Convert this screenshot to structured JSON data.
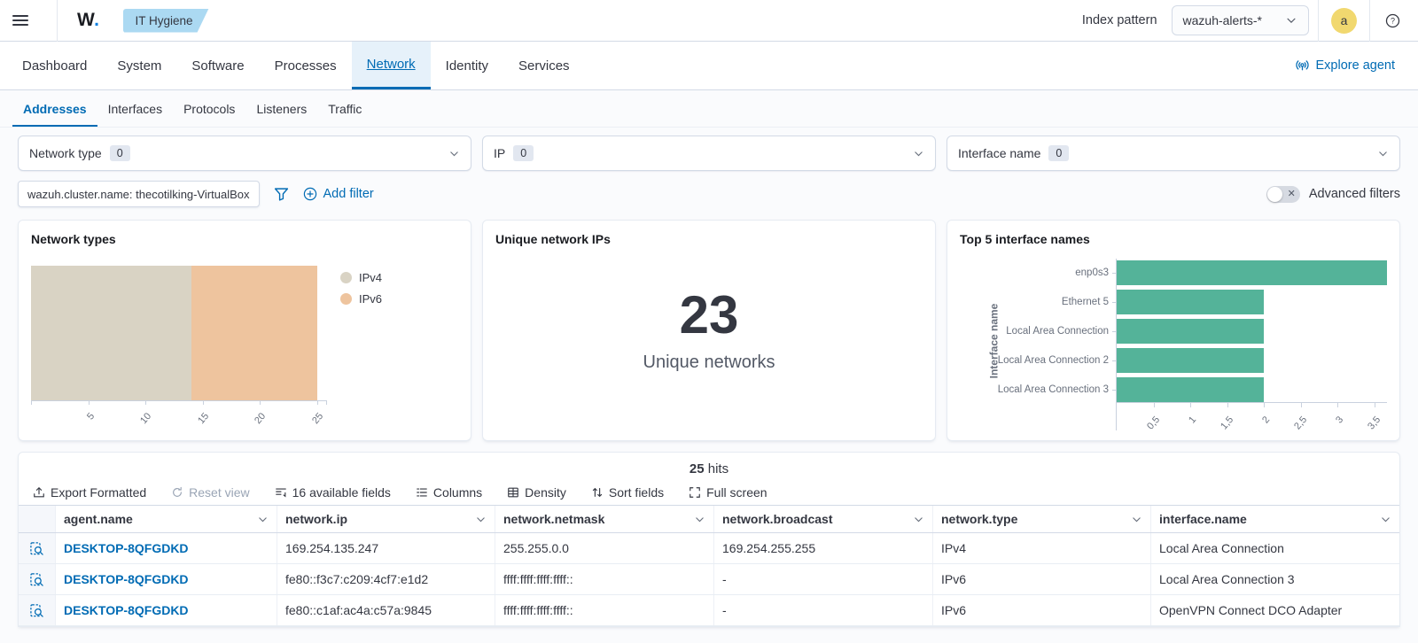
{
  "colors": {
    "accent_blue": "#006BB4",
    "badge_blue": "#abd9f2",
    "avatar_yellow": "#f1d86f",
    "bar_green": "#54b399",
    "ipv4_beige": "#d9d3c4",
    "ipv6_peach": "#eec49e"
  },
  "icons": {
    "menu-icon": "hamburger bars",
    "chevron-down-icon": "v chevron",
    "help-icon": "? in circle",
    "filter-funnel-icon": "funnel outline",
    "add-circle-icon": "plus in circle",
    "broadcast-icon": "((o)) signal",
    "export-icon": "arrow up from tray",
    "refresh-icon": "circular arrow",
    "fields-icon": "list with arrow",
    "columns-icon": "list lines",
    "density-icon": "table grid",
    "sort-icon": "up down arrows",
    "fullscreen-icon": "expand corners",
    "inspect-icon": "document with magnifier",
    "close-icon": "x mark"
  },
  "header": {
    "logo_text": "W",
    "logo_dot": ".",
    "module_badge": "IT Hygiene",
    "index_pattern_label": "Index pattern",
    "index_pattern_value": "wazuh-alerts-*",
    "avatar_initial": "a"
  },
  "nav": {
    "tabs": [
      "Dashboard",
      "System",
      "Software",
      "Processes",
      "Network",
      "Identity",
      "Services"
    ],
    "active": "Network",
    "explore_agent": "Explore agent"
  },
  "subnav": {
    "tabs": [
      "Addresses",
      "Interfaces",
      "Protocols",
      "Listeners",
      "Traffic"
    ],
    "active": "Addresses"
  },
  "filters": {
    "combos": [
      {
        "label": "Network type",
        "count": "0"
      },
      {
        "label": "IP",
        "count": "0"
      },
      {
        "label": "Interface name",
        "count": "0"
      }
    ],
    "pill": "wazuh.cluster.name: thecotilking-VirtualBox",
    "add_filter": "Add filter",
    "advanced_filters": "Advanced filters"
  },
  "chart_data": [
    {
      "type": "bar",
      "variant": "horizontal-stacked",
      "title": "Network types",
      "series": [
        {
          "name": "IPv4",
          "value": 14,
          "color": "#d9d3c4"
        },
        {
          "name": "IPv6",
          "value": 11,
          "color": "#eec49e"
        }
      ],
      "xlim": [
        0,
        25
      ],
      "x_ticks": [
        5,
        10,
        15,
        20,
        25
      ],
      "legend_position": "right",
      "grid": false
    },
    {
      "type": "metric",
      "title": "Unique network IPs",
      "value": "23",
      "label": "Unique networks"
    },
    {
      "type": "bar",
      "variant": "horizontal",
      "title": "Top 5 interface names",
      "ylabel": "Interface name",
      "categories": [
        "enp0s3",
        "Ethernet 5",
        "Local Area Connection",
        "Local Area Connection 2",
        "Local Area Connection 3"
      ],
      "values": [
        4,
        2,
        2,
        2,
        2
      ],
      "xlim": [
        0,
        4
      ],
      "x_ticks": [
        "0,5",
        "1",
        "1,5",
        "2",
        "2,5",
        "3",
        "3,5"
      ],
      "bar_color": "#54b399",
      "grid": false
    }
  ],
  "table": {
    "hits_count": "25",
    "hits_label": "hits",
    "toolbar": [
      "Export Formatted",
      "Reset view",
      "16 available fields",
      "Columns",
      "Density",
      "Sort fields",
      "Full screen"
    ],
    "columns": [
      "agent.name",
      "network.ip",
      "network.netmask",
      "network.broadcast",
      "network.type",
      "interface.name"
    ],
    "rows": [
      [
        "DESKTOP-8QFGDKD",
        "169.254.135.247",
        "255.255.0.0",
        "169.254.255.255",
        "IPv4",
        "Local Area Connection"
      ],
      [
        "DESKTOP-8QFGDKD",
        "fe80::f3c7:c209:4cf7:e1d2",
        "ffff:ffff:ffff:ffff::",
        "-",
        "IPv6",
        "Local Area Connection 3"
      ],
      [
        "DESKTOP-8QFGDKD",
        "fe80::c1af:ac4a:c57a:9845",
        "ffff:ffff:ffff:ffff::",
        "-",
        "IPv6",
        "OpenVPN Connect DCO Adapter"
      ]
    ]
  }
}
